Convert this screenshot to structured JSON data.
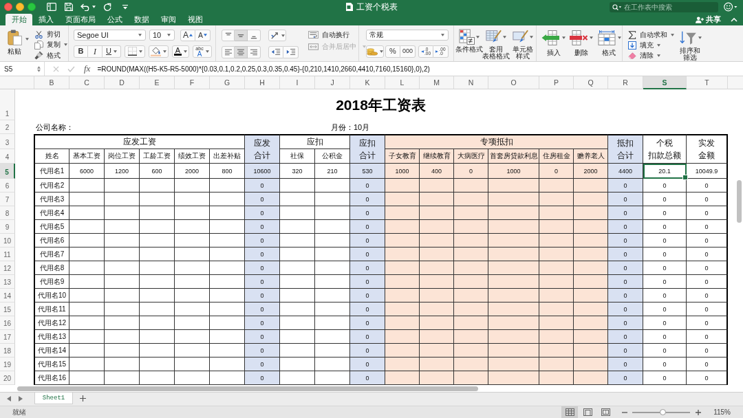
{
  "window": {
    "title": "工资个税表"
  },
  "search": {
    "placeholder": "在工作表中搜索"
  },
  "ribbon_tabs": [
    {
      "label": "开始",
      "selected": true
    },
    {
      "label": "插入",
      "selected": false
    },
    {
      "label": "页面布局",
      "selected": false
    },
    {
      "label": "公式",
      "selected": false
    },
    {
      "label": "数据",
      "selected": false
    },
    {
      "label": "审阅",
      "selected": false
    },
    {
      "label": "视图",
      "selected": false
    }
  ],
  "share_button": {
    "label": "共享"
  },
  "ribbon": {
    "clipboard": {
      "paste": "粘贴",
      "actions": [
        {
          "kind": "cut",
          "label": "剪切"
        },
        {
          "kind": "copy",
          "label": "复制"
        },
        {
          "kind": "format_painter",
          "label": "格式"
        }
      ]
    },
    "font": {
      "name": "Segoe UI",
      "size": "10",
      "grow": "A",
      "shrink": "A",
      "styles": [
        {
          "kind": "bold",
          "label": "B"
        },
        {
          "kind": "italic",
          "label": "I"
        },
        {
          "kind": "underline",
          "label": "U"
        }
      ],
      "font_color": "A",
      "phonetic": [
        "abc",
        "A"
      ]
    },
    "alignment": {
      "vertical": [
        {
          "kind": "top",
          "selected": false
        },
        {
          "kind": "middle",
          "selected": true
        },
        {
          "kind": "bottom",
          "selected": false
        }
      ],
      "horizontal": [
        {
          "kind": "left",
          "selected": false
        },
        {
          "kind": "center",
          "selected": true
        },
        {
          "kind": "right",
          "selected": false
        }
      ],
      "wrap_text": "自动换行",
      "merge": {
        "label": "合并后居中",
        "disabled": true
      }
    },
    "number": {
      "format": "常规",
      "buttons": [
        {
          "kind": "percent",
          "label": "%"
        },
        {
          "kind": "thousands",
          "label": "000"
        }
      ],
      "decimals": [
        {
          "kind": "increase",
          "lines": [
            ".0",
            ".00"
          ]
        },
        {
          "kind": "decrease",
          "lines": [
            ".00",
            ".0"
          ]
        }
      ]
    },
    "styles": [
      {
        "kind": "conditional",
        "lines": [
          "条件格式"
        ]
      },
      {
        "kind": "table",
        "lines": [
          "套用",
          "表格格式"
        ]
      },
      {
        "kind": "cell",
        "lines": [
          "单元格",
          "样式"
        ]
      }
    ],
    "cells": [
      {
        "kind": "insert",
        "label": "插入"
      },
      {
        "kind": "delete",
        "label": "删除"
      },
      {
        "kind": "format",
        "label": "格式"
      }
    ],
    "editing": {
      "actions": [
        {
          "kind": "autosum",
          "label": "自动求和"
        },
        {
          "kind": "fill",
          "label": "填充"
        },
        {
          "kind": "clear",
          "label": "清除"
        }
      ],
      "sort_filter": [
        "排序和",
        "筛选"
      ]
    }
  },
  "formula_bar": {
    "cell_ref": "S5",
    "function_label": "fx",
    "formula": "=ROUND(MAX((H5-K5-R5-5000)*{0.03,0.1,0.2,0.25,0.3,0.35,0.45}-{0,210,1410,2660,4410,7160,15160},0),2)"
  },
  "column_headers": [
    {
      "label": "B",
      "selected": false
    },
    {
      "label": "C",
      "selected": false
    },
    {
      "label": "D",
      "selected": false
    },
    {
      "label": "E",
      "selected": false
    },
    {
      "label": "F",
      "selected": false
    },
    {
      "label": "G",
      "selected": false
    },
    {
      "label": "H",
      "selected": false
    },
    {
      "label": "I",
      "selected": false
    },
    {
      "label": "J",
      "selected": false
    },
    {
      "label": "K",
      "selected": false
    },
    {
      "label": "L",
      "selected": false
    },
    {
      "label": "M",
      "selected": false
    },
    {
      "label": "N",
      "selected": false
    },
    {
      "label": "O",
      "selected": false
    },
    {
      "label": "P",
      "selected": false
    },
    {
      "label": "Q",
      "selected": false
    },
    {
      "label": "R",
      "selected": false
    },
    {
      "label": "S",
      "selected": true
    },
    {
      "label": "T",
      "selected": false
    }
  ],
  "row_headers": [
    {
      "label": "1",
      "selected": false
    },
    {
      "label": "2",
      "selected": false
    },
    {
      "label": "3",
      "selected": false
    },
    {
      "label": "4",
      "selected": false
    },
    {
      "label": "5",
      "selected": true
    },
    {
      "label": "6",
      "selected": false
    },
    {
      "label": "7",
      "selected": false
    },
    {
      "label": "8",
      "selected": false
    },
    {
      "label": "9",
      "selected": false
    },
    {
      "label": "10",
      "selected": false
    },
    {
      "label": "11",
      "selected": false
    },
    {
      "label": "12",
      "selected": false
    },
    {
      "label": "13",
      "selected": false
    },
    {
      "label": "14",
      "selected": false
    },
    {
      "label": "15",
      "selected": false
    },
    {
      "label": "16",
      "selected": false
    },
    {
      "label": "17",
      "selected": false
    },
    {
      "label": "18",
      "selected": false
    },
    {
      "label": "19",
      "selected": false
    },
    {
      "label": "20",
      "selected": false
    }
  ],
  "sheet": {
    "title": "2018年工资表",
    "company_label": "公司名称：",
    "month_label": "月份：10月",
    "header": [
      {
        "kind": "group",
        "label": "应发工资",
        "color": "#ffffff",
        "columns": [
          "姓名",
          "基本工资",
          "岗位工资",
          "工龄工资",
          "绩效工资",
          "出差补贴"
        ]
      },
      {
        "kind": "single",
        "lines": [
          "应发",
          "合计"
        ],
        "color": "#d9e1f2"
      },
      {
        "kind": "group",
        "label": "应扣",
        "color": "#ffffff",
        "columns": [
          "社保",
          "公积金"
        ]
      },
      {
        "kind": "single",
        "lines": [
          "应扣",
          "合计"
        ],
        "color": "#d9e1f2"
      },
      {
        "kind": "group",
        "label": "专项抵扣",
        "color": "#fce4d6",
        "columns": [
          "子女教育",
          "继续教育",
          "大病医疗",
          "首套房贷款利息",
          "住房租金",
          "赡养老人"
        ]
      },
      {
        "kind": "single",
        "lines": [
          "抵扣",
          "合计"
        ],
        "color": "#d9e1f2"
      },
      {
        "kind": "single",
        "lines": [
          "个税",
          "扣款总额"
        ],
        "color": "#ffffff"
      },
      {
        "kind": "single",
        "lines": [
          "实发",
          "金额"
        ],
        "color": "#ffffff"
      }
    ],
    "rows": [
      [
        "代用名1",
        "6000",
        "1200",
        "600",
        "2000",
        "800",
        "10600",
        "320",
        "210",
        "530",
        "1000",
        "400",
        "0",
        "1000",
        "0",
        "2000",
        "4400",
        "20.1",
        "10049.9"
      ],
      [
        "代用名2",
        null,
        null,
        null,
        null,
        null,
        "0",
        null,
        null,
        "0",
        null,
        null,
        null,
        null,
        null,
        null,
        "0",
        "0",
        "0"
      ],
      [
        "代用名3",
        null,
        null,
        null,
        null,
        null,
        "0",
        null,
        null,
        "0",
        null,
        null,
        null,
        null,
        null,
        null,
        "0",
        "0",
        "0"
      ],
      [
        "代用名4",
        null,
        null,
        null,
        null,
        null,
        "0",
        null,
        null,
        "0",
        null,
        null,
        null,
        null,
        null,
        null,
        "0",
        "0",
        "0"
      ],
      [
        "代用名5",
        null,
        null,
        null,
        null,
        null,
        "0",
        null,
        null,
        "0",
        null,
        null,
        null,
        null,
        null,
        null,
        "0",
        "0",
        "0"
      ],
      [
        "代用名6",
        null,
        null,
        null,
        null,
        null,
        "0",
        null,
        null,
        "0",
        null,
        null,
        null,
        null,
        null,
        null,
        "0",
        "0",
        "0"
      ],
      [
        "代用名7",
        null,
        null,
        null,
        null,
        null,
        "0",
        null,
        null,
        "0",
        null,
        null,
        null,
        null,
        null,
        null,
        "0",
        "0",
        "0"
      ],
      [
        "代用名8",
        null,
        null,
        null,
        null,
        null,
        "0",
        null,
        null,
        "0",
        null,
        null,
        null,
        null,
        null,
        null,
        "0",
        "0",
        "0"
      ],
      [
        "代用名9",
        null,
        null,
        null,
        null,
        null,
        "0",
        null,
        null,
        "0",
        null,
        null,
        null,
        null,
        null,
        null,
        "0",
        "0",
        "0"
      ],
      [
        "代用名10",
        null,
        null,
        null,
        null,
        null,
        "0",
        null,
        null,
        "0",
        null,
        null,
        null,
        null,
        null,
        null,
        "0",
        "0",
        "0"
      ],
      [
        "代用名11",
        null,
        null,
        null,
        null,
        null,
        "0",
        null,
        null,
        "0",
        null,
        null,
        null,
        null,
        null,
        null,
        "0",
        "0",
        "0"
      ],
      [
        "代用名12",
        null,
        null,
        null,
        null,
        null,
        "0",
        null,
        null,
        "0",
        null,
        null,
        null,
        null,
        null,
        null,
        "0",
        "0",
        "0"
      ],
      [
        "代用名13",
        null,
        null,
        null,
        null,
        null,
        "0",
        null,
        null,
        "0",
        null,
        null,
        null,
        null,
        null,
        null,
        "0",
        "0",
        "0"
      ],
      [
        "代用名14",
        null,
        null,
        null,
        null,
        null,
        "0",
        null,
        null,
        "0",
        null,
        null,
        null,
        null,
        null,
        null,
        "0",
        "0",
        "0"
      ],
      [
        "代用名15",
        null,
        null,
        null,
        null,
        null,
        "0",
        null,
        null,
        "0",
        null,
        null,
        null,
        null,
        null,
        null,
        "0",
        "0",
        "0"
      ],
      [
        "代用名16",
        null,
        null,
        null,
        null,
        null,
        "0",
        null,
        null,
        "0",
        null,
        null,
        null,
        null,
        null,
        null,
        "0",
        "0",
        "0"
      ]
    ]
  },
  "sheet_tabs": [
    {
      "label": "Sheet1",
      "selected": true
    }
  ],
  "status_bar": {
    "status": "就绪",
    "views": [
      {
        "kind": "normal",
        "selected": true
      },
      {
        "kind": "page_layout",
        "selected": false
      },
      {
        "kind": "page_break",
        "selected": false
      }
    ],
    "zoom": {
      "level": 0.52,
      "label": "115%"
    }
  }
}
